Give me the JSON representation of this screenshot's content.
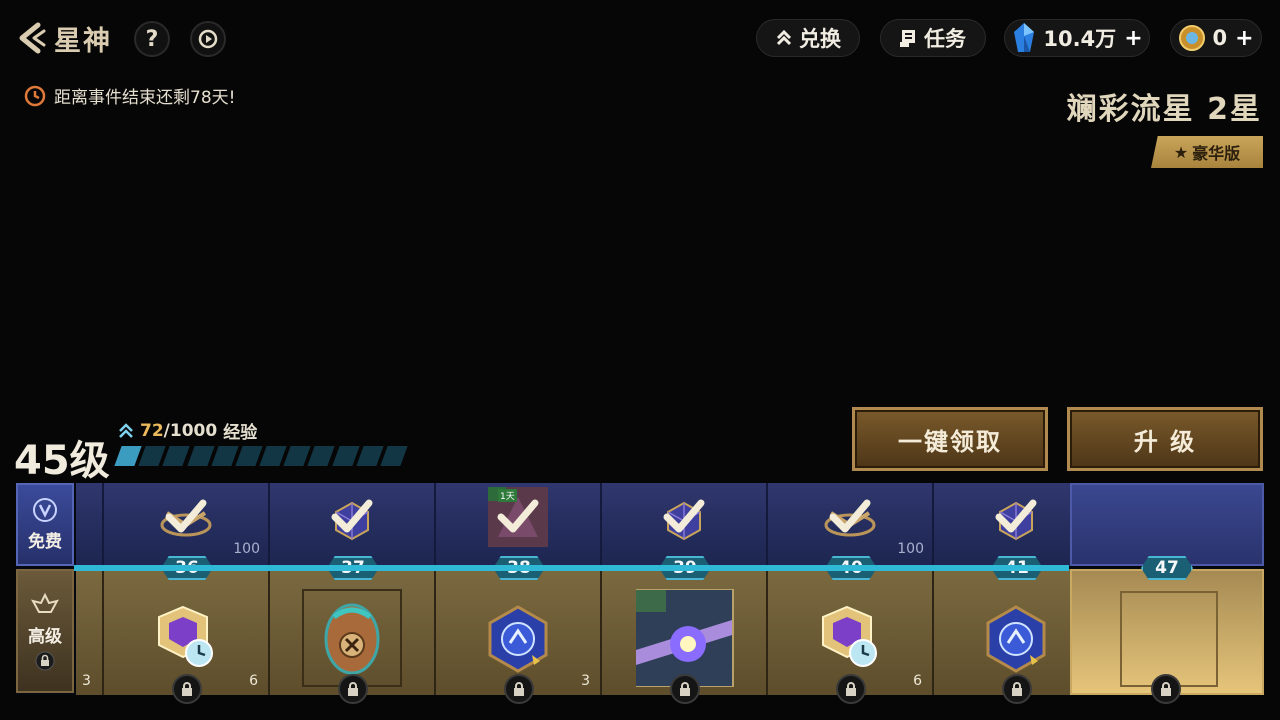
{
  "header": {
    "title": "星神",
    "help_label": "?",
    "exchange_label": "兑换",
    "tasks_label": "任务",
    "gems_value": "10.4万",
    "coins_value": "0",
    "plus": "+"
  },
  "event": {
    "timer_text": "距离事件结束还剩78天!"
  },
  "season": {
    "name": "斓彩流星 2星",
    "edition": "豪华版"
  },
  "progress": {
    "level": "45级",
    "exp_current": "72",
    "exp_total": "/1000",
    "exp_label": "经验",
    "exp_fraction": 0.072
  },
  "buttons": {
    "claim_all": "一键领取",
    "upgrade": "升 级"
  },
  "track": {
    "free_label": "免费",
    "premium_label": "高级",
    "first_prem_count": "3",
    "levels": [
      {
        "level": "36",
        "free_count": "100",
        "prem_count": "6"
      },
      {
        "level": "37",
        "free_count": "",
        "prem_count": ""
      },
      {
        "level": "38",
        "free_count": "",
        "prem_count": "3"
      },
      {
        "level": "39",
        "free_count": "",
        "prem_count": ""
      },
      {
        "level": "40",
        "free_count": "100",
        "prem_count": "6"
      },
      {
        "level": "41",
        "free_count": "",
        "prem_count": ""
      },
      {
        "level": "47",
        "free_count": "",
        "prem_count": ""
      }
    ],
    "mini_badge": "1天"
  },
  "colors": {
    "accent_cyan": "#2fb9d6",
    "gold": "#c9a55b",
    "free_blue": "#2f376e"
  }
}
